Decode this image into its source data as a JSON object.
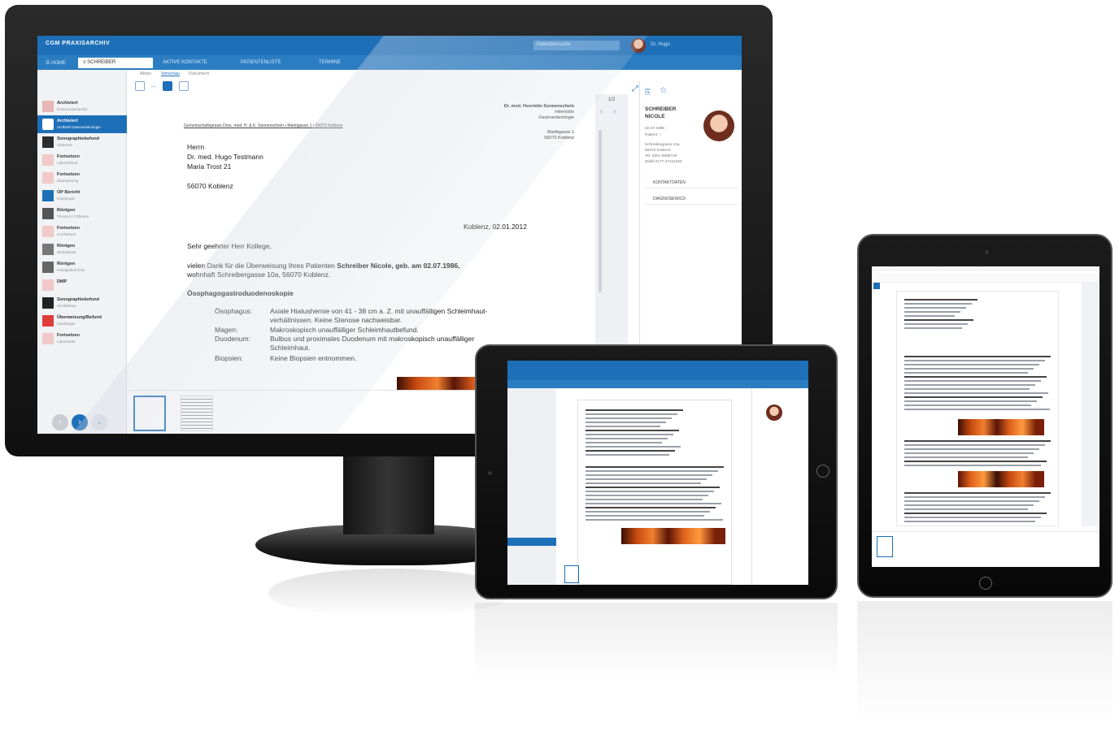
{
  "app": {
    "title": "CGM PRAXISARCHIV",
    "search_placeholder": "Patientensuche",
    "user_name": "Dr. Hugo"
  },
  "tabs": [
    {
      "label": "☰ HOME"
    },
    {
      "label": "≡ SCHREIBER"
    },
    {
      "label": "AKTIVE KONTAKTE"
    },
    {
      "label": "PATIENTENLISTE"
    },
    {
      "label": "TERMINE"
    }
  ],
  "view_tabs": [
    "Akten",
    "Vorschau",
    "Dokument"
  ],
  "sidebar": {
    "items": [
      {
        "title": "Archiviert",
        "sub": "Dokumentenarchiv"
      },
      {
        "title": "Archiviert",
        "sub": "Arztbrief Gastroenterologie",
        "active": true
      },
      {
        "title": "Sonographiebefund",
        "sub": "Abdomen"
      },
      {
        "title": "Fortsetzen",
        "sub": "Laborbefund"
      },
      {
        "title": "Fortsetzen",
        "sub": "Überweisung"
      },
      {
        "title": "OP Bericht",
        "sub": "Koloskopie"
      },
      {
        "title": "Röntgen",
        "sub": "Thorax in 2 Ebenen"
      },
      {
        "title": "Fortsetzen",
        "sub": "Kurzbefund"
      },
      {
        "title": "Röntgen",
        "sub": "Wirbelsäule"
      },
      {
        "title": "Röntgen",
        "sub": "Handgelenk links"
      },
      {
        "title": "DMP",
        "sub": ""
      },
      {
        "title": "Sonographiebefund",
        "sub": "Schilddrüse"
      },
      {
        "title": "Überweisung/Befund",
        "sub": "Kardiologie"
      },
      {
        "title": "Fortsetzen",
        "sub": "Laborwerte"
      }
    ]
  },
  "document": {
    "sender_name": "Dr. med. Henriette Sonnenschein",
    "sender_lines": [
      "Internistin",
      "Gastroenterologie",
      "Marktgasse 1",
      "56070 Koblenz"
    ],
    "return_line": "Gemeinschaftspraxis Dres. med. H. & K. Sonnenschein • Marktgasse 1 • 56070 Koblenz",
    "addr": [
      "Herrn",
      "Dr. med. Hugo Testmann",
      "Maria Trost 21",
      "",
      "56070 Koblenz"
    ],
    "date_line": "Koblenz, 02.01.2012",
    "salutation": "Sehr geehrter Herr Kollege,",
    "intro_1": "vielen Dank für die Überweisung Ihres Patienten ",
    "intro_bold": "Schreiber Nicole, geb. am 02.07.1986,",
    "intro_2": "wohnhaft Schreibergasse 10a, 56070 Koblenz.",
    "heading": "Ösophagogastroduodenoskopie",
    "findings": [
      {
        "label": "Ösophagus:",
        "text": "Axiale Hiatushernie von 41 - 38 cm a. Z. mit unauffälligen Schleimhaut-"
      },
      {
        "label": "",
        "text": "verhältnissen. Keine Stenose nachweisbar."
      },
      {
        "label": "Magen:",
        "text": "Makroskopisch unauffälliger Schleimhautbefund."
      },
      {
        "label": "Duodenum:",
        "text": "Bulbus und proximales Duodenum mit makroskopisch unauffälliger"
      },
      {
        "label": "",
        "text": "Schleimhaut."
      },
      {
        "label": "Biopsien:",
        "text": "Keine Biopsien entnommen."
      }
    ]
  },
  "pager": {
    "label": "1/2"
  },
  "patient": {
    "last_name": "SCHREIBER",
    "first_name": "NICOLE",
    "dob": "02.07.1986",
    "age": "Patient: ♀",
    "address": "Schreibergasse 10a",
    "city": "56070 Koblenz",
    "phone": "Tel. 0261 9988740",
    "mobile": "Mobil 0177 27111333",
    "sections": [
      "KONTAKTDATEN",
      "DIAGNOSEN/ICD"
    ]
  },
  "colors": {
    "brand": "#1d6fb8",
    "tabbar": "#2b7dc2"
  }
}
